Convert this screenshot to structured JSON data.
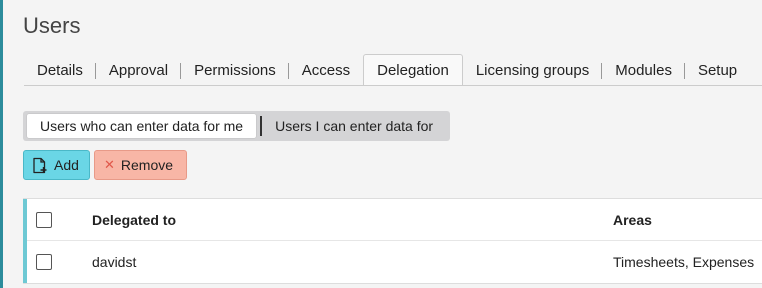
{
  "page": {
    "title": "Users"
  },
  "tabs": [
    {
      "label": "Details"
    },
    {
      "label": "Approval"
    },
    {
      "label": "Permissions"
    },
    {
      "label": "Access"
    },
    {
      "label": "Delegation",
      "active": true
    },
    {
      "label": "Licensing groups"
    },
    {
      "label": "Modules"
    },
    {
      "label": "Setup"
    }
  ],
  "segment": {
    "options": [
      {
        "label": "Users who can enter data for me",
        "active": true
      },
      {
        "label": "Users I can enter data for"
      }
    ]
  },
  "toolbar": {
    "add_label": "Add",
    "add_icon": "add-document-icon",
    "remove_label": "Remove",
    "remove_icon": "close-icon"
  },
  "table": {
    "columns": [
      "Delegated to",
      "Areas"
    ],
    "rows": [
      {
        "delegated_to": "davidst",
        "areas": "Timesheets, Expenses"
      }
    ]
  },
  "colors": {
    "accent": "#2c8c9c",
    "add_button": "#6ad6e6",
    "remove_button": "#f8b6a6",
    "remove_icon": "#e0584a"
  }
}
